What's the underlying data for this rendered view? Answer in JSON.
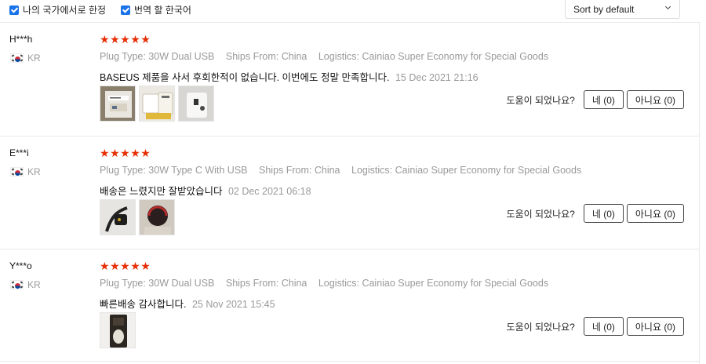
{
  "filters": {
    "own_country": "나의 국가에서로 한정",
    "translate": "번역 할 한국어"
  },
  "sort": {
    "label": "Sort by default"
  },
  "colors": {
    "accent_checkbox": "#1a73e8",
    "star": "#e62e04"
  },
  "reviews": [
    {
      "user": "H***h",
      "country": "KR",
      "rating": 5,
      "plug_type": "Plug Type: 30W Dual USB",
      "ships_from": "Ships From: China",
      "logistics": "Logistics: Cainiao Super Economy for Special Goods",
      "text": "BASEUS 제품을 사서 후회한적이 없습니다. 이번에도 정말 만족합니다.",
      "date": "15 Dec 2021 21:16",
      "helpful_question": "도움이 되었나요?",
      "yes_label": "네 (0)",
      "no_label": "아니요 (0)"
    },
    {
      "user": "E***i",
      "country": "KR",
      "rating": 5,
      "plug_type": "Plug Type: 30W Type C With USB",
      "ships_from": "Ships From: China",
      "logistics": "Logistics: Cainiao Super Economy for Special Goods",
      "text": "배송은 느렸지만 잘받았습니다",
      "date": "02 Dec 2021 06:18",
      "helpful_question": "도움이 되었나요?",
      "yes_label": "네 (0)",
      "no_label": "아니요 (0)"
    },
    {
      "user": "Y***o",
      "country": "KR",
      "rating": 5,
      "plug_type": "Plug Type: 30W Dual USB",
      "ships_from": "Ships From: China",
      "logistics": "Logistics: Cainiao Super Economy for Special Goods",
      "text": "빠른배송 감사합니다.",
      "date": "25 Nov 2021 15:45",
      "helpful_question": "도움이 되었나요?",
      "yes_label": "네 (0)",
      "no_label": "아니요 (0)"
    }
  ]
}
